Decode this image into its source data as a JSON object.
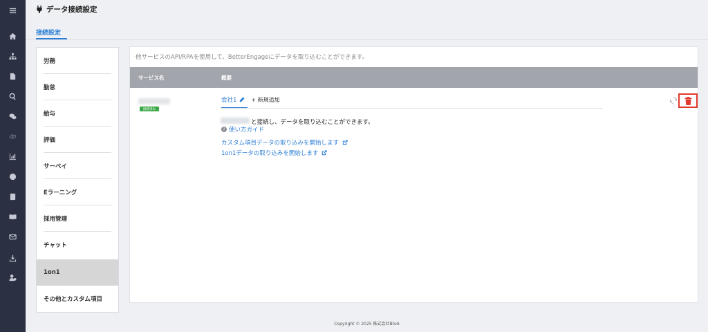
{
  "header": {
    "title": "データ接続設定"
  },
  "tabs": [
    {
      "label": "接続設定"
    }
  ],
  "categories": [
    {
      "label": "労務"
    },
    {
      "label": "勤怠"
    },
    {
      "label": "給与"
    },
    {
      "label": "評価"
    },
    {
      "label": "サーベイ"
    },
    {
      "label": "Eラーニング"
    },
    {
      "label": "採用管理"
    },
    {
      "label": "チャット"
    },
    {
      "label": "1on1",
      "active": true
    },
    {
      "label": "その他とカスタム項目"
    }
  ],
  "main": {
    "description": "他サービスのAPI/RPAを使用して、BetterEngageにデータを取り込むことができます。",
    "columns": {
      "service_name": "サービス名",
      "overview": "概要"
    },
    "row": {
      "status_badge": "接続済み",
      "subtabs": {
        "company": "会社1",
        "add_new": "+ 新規追加"
      },
      "connect_text": "と接続し、データを取り込むことができます。",
      "guide_link": "使い方ガイド",
      "links": [
        "カスタム項目データの取り込みを開始します",
        "1on1データの取り込みを開始します"
      ]
    }
  },
  "footer": {
    "copyright": "Copyright © 2025 株式会社BtoA"
  },
  "icons": {
    "rail": [
      "menu-icon",
      "home-icon",
      "org-chart-icon",
      "document-icon",
      "search-icon",
      "chat-icon",
      "link-icon",
      "chart-icon",
      "globe-icon",
      "contact-card-icon",
      "book-icon",
      "mail-icon",
      "download-icon",
      "user-settings-icon"
    ]
  },
  "colors": {
    "accent": "#2f7fd6",
    "danger": "#e3392d",
    "success": "#3aa845",
    "rail": "#2b3142"
  }
}
